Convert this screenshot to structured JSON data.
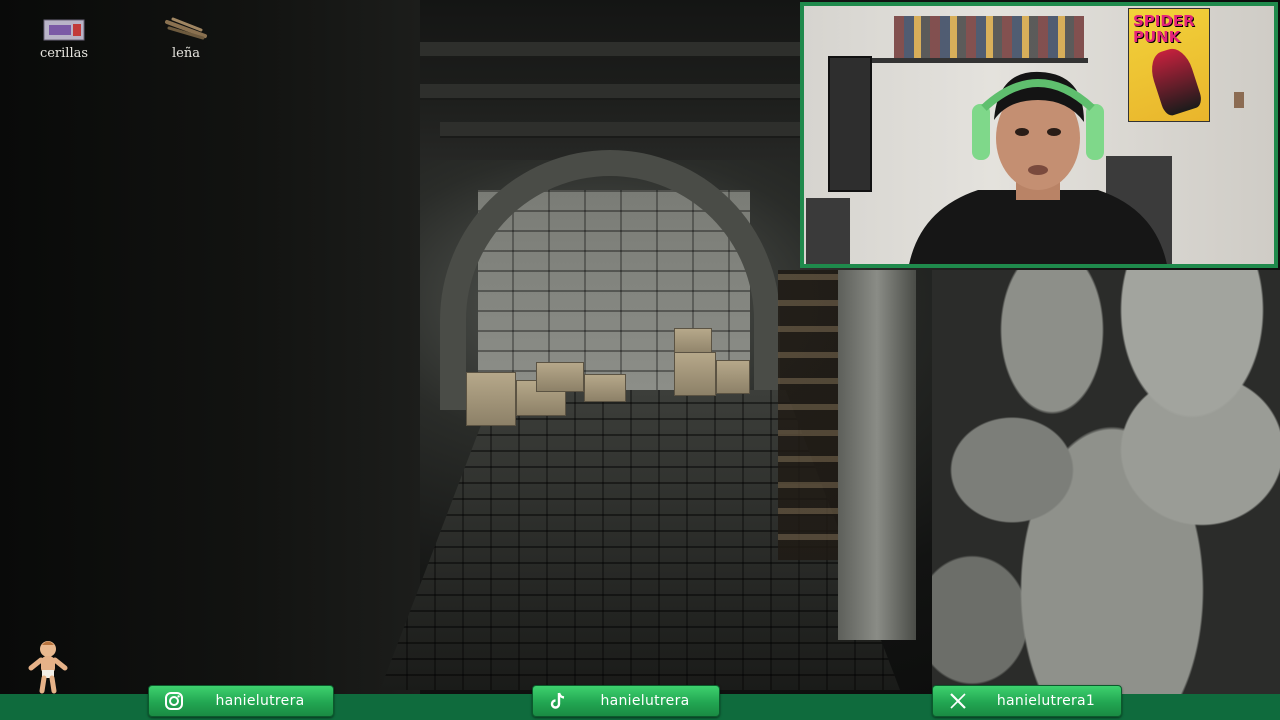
{
  "inventory": [
    {
      "label": "cerillas",
      "icon": "matchbox-icon"
    },
    {
      "label": "leña",
      "icon": "firewood-icon"
    }
  ],
  "hud": {
    "companion_icon": "baby-doll-icon"
  },
  "webcam": {
    "poster_text_line1": "SPIDER",
    "poster_text_line2": "PUNK"
  },
  "social": [
    {
      "platform": "instagram",
      "icon": "instagram-icon",
      "handle": "hanielutrera"
    },
    {
      "platform": "tiktok",
      "icon": "tiktok-icon",
      "handle": "hanielutrera"
    },
    {
      "platform": "x",
      "icon": "x-icon",
      "handle": "hanielutrera1"
    }
  ],
  "colors": {
    "accent_green": "#22a652",
    "bar_green": "#0f6b3d",
    "webcam_border": "#1f8a4c"
  }
}
